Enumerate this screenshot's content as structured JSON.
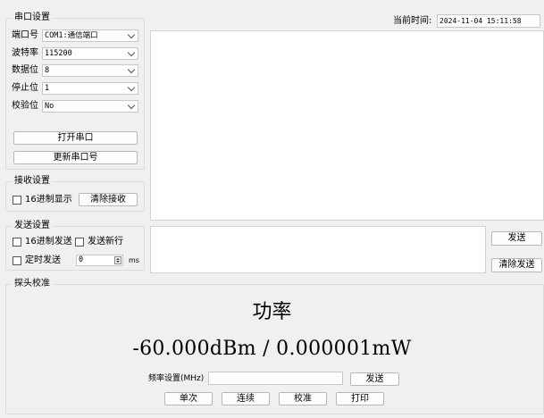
{
  "serial_settings": {
    "title": "串口设置",
    "fields": [
      {
        "label": "端口号",
        "value": "COM1:通信端口"
      },
      {
        "label": "波特率",
        "value": "115200"
      },
      {
        "label": "数据位",
        "value": "8"
      },
      {
        "label": "停止位",
        "value": "1"
      },
      {
        "label": "校验位",
        "value": "No"
      }
    ],
    "open_button": "打开串口",
    "refresh_button": "更新串口号"
  },
  "receive_settings": {
    "title": "接收设置",
    "hex_display_label": "16进制显示",
    "hex_display_checked": false,
    "clear_button": "清除接收"
  },
  "send_settings": {
    "title": "发送设置",
    "hex_send_label": "16进制发送",
    "hex_send_checked": false,
    "newline_label": "发送新行",
    "newline_checked": false,
    "timed_send_label": "定时发送",
    "timed_send_checked": false,
    "interval_value": "0",
    "interval_unit": "ms"
  },
  "current_time": {
    "label": "当前时间:",
    "value": "2024-11-04 15:11:58"
  },
  "send_area": {
    "send_button": "发送",
    "clear_send_button": "清除发送"
  },
  "probe_calibration": {
    "title": "探头校准",
    "power_title": "功率",
    "power_reading": "-60.000dBm / 0.000001mW",
    "freq_label": "频率设置(MHz)",
    "freq_value": "",
    "freq_send_button": "发送",
    "buttons": [
      "单次",
      "连续",
      "校准",
      "打印"
    ]
  }
}
